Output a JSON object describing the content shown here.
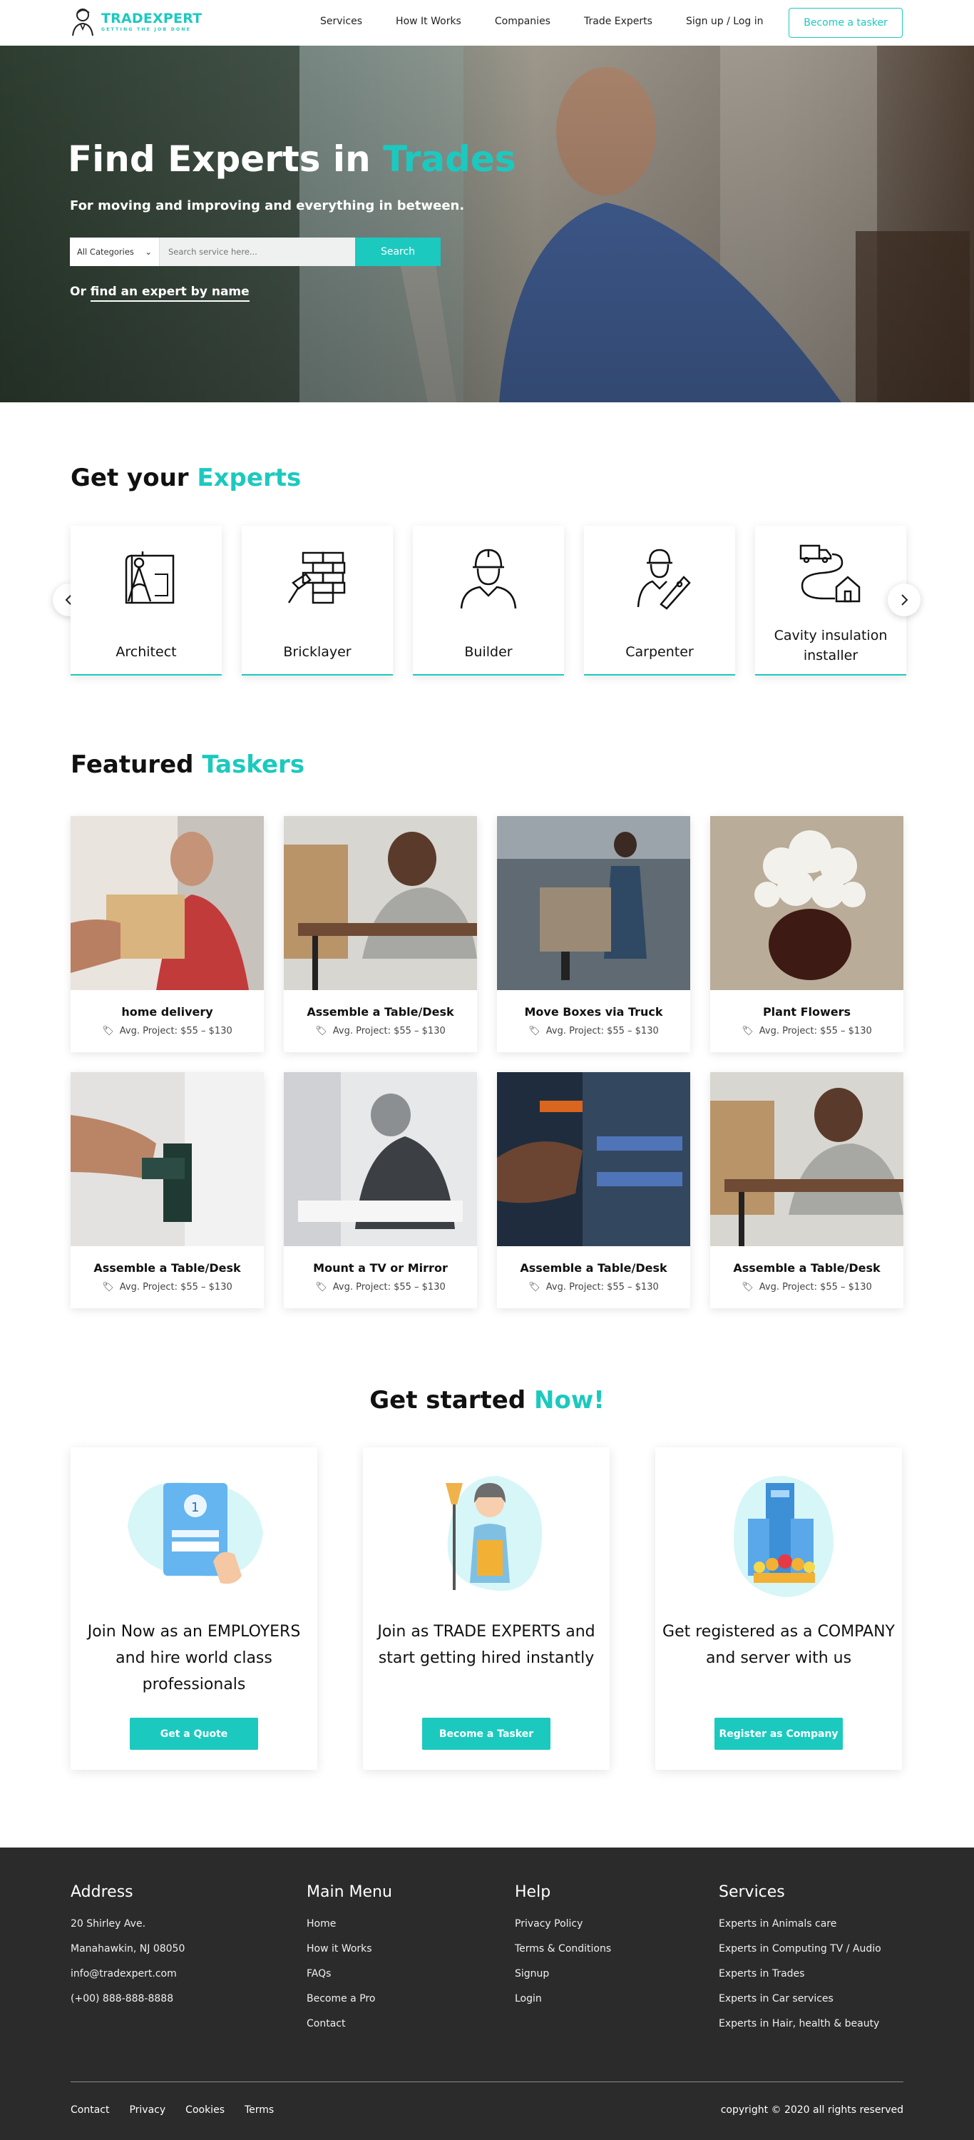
{
  "header": {
    "logo_name": "TRADEXPERT",
    "logo_tagline": "GETTING THE JOB DONE",
    "nav": [
      "Services",
      "How It Works",
      "Companies",
      "Trade Experts",
      "Sign up / Log in"
    ],
    "cta": "Become a tasker"
  },
  "hero": {
    "title_main": "Find Experts in ",
    "title_accent": "Trades",
    "subtitle": "For moving and improving and everything in between.",
    "category_selected": "All Categories",
    "search_placeholder": "Search service here...",
    "search_button": "Search",
    "find_prefix": "Or ",
    "find_link": "find an expert by name"
  },
  "experts": {
    "title_main": "Get your ",
    "title_accent": "Experts",
    "items": [
      {
        "label": "Architect",
        "icon": "architect-icon"
      },
      {
        "label": "Bricklayer",
        "icon": "bricklayer-icon"
      },
      {
        "label": "Builder",
        "icon": "builder-icon"
      },
      {
        "label": "Carpenter",
        "icon": "carpenter-icon"
      },
      {
        "label": "Cavity insulation installer",
        "icon": "cavity-insulation-icon"
      }
    ]
  },
  "taskers": {
    "title_main": "Featured ",
    "title_accent": "Taskers",
    "items": [
      {
        "name": "home delivery",
        "price": "Avg. Project: $55 – $130"
      },
      {
        "name": "Assemble a Table/Desk",
        "price": "Avg. Project: $55 – $130"
      },
      {
        "name": "Move Boxes via Truck",
        "price": "Avg. Project: $55 – $130"
      },
      {
        "name": "Plant Flowers",
        "price": "Avg. Project: $55 – $130"
      },
      {
        "name": "Assemble a Table/Desk",
        "price": "Avg. Project: $55 – $130"
      },
      {
        "name": "Mount a TV or Mirror",
        "price": "Avg. Project: $55 – $130"
      },
      {
        "name": "Assemble a Table/Desk",
        "price": "Avg. Project: $55 – $130"
      },
      {
        "name": "Assemble a Table/Desk",
        "price": "Avg. Project: $55 – $130"
      }
    ]
  },
  "get_started": {
    "title_main": "Get started ",
    "title_accent": "Now!",
    "cards": [
      {
        "text": "Join Now as an EMPLOYERS and hire world class professionals",
        "button": "Get a Quote"
      },
      {
        "text": "Join as TRADE EXPERTS and start getting hired instantly",
        "button": "Become a Tasker"
      },
      {
        "text": "Get registered as a COMPANY and server with us",
        "button": "Register as Company"
      }
    ]
  },
  "footer": {
    "address": {
      "heading": "Address",
      "lines": [
        "20 Shirley Ave.",
        "Manahawkin, NJ 08050",
        "info@tradexpert.com",
        "(+00) 888-888-8888"
      ]
    },
    "main_menu": {
      "heading": "Main Menu",
      "links": [
        "Home",
        "How it Works",
        "FAQs",
        "Become a Pro",
        "Contact"
      ]
    },
    "help": {
      "heading": "Help",
      "links": [
        "Privacy Policy",
        "Terms & Conditions",
        "Signup",
        "Login"
      ]
    },
    "services": {
      "heading": "Services",
      "links": [
        "Experts in Animals care",
        "Experts in Computing TV / Audio",
        "Experts in Trades",
        "Experts in Car services",
        "Experts in Hair, health & beauty"
      ]
    },
    "bottom_links": [
      "Contact",
      "Privacy",
      "Cookies",
      "Terms"
    ],
    "copyright": "copyright © 2020 all rights reserved"
  },
  "colors": {
    "accent": "#1cc9bf",
    "footer_bg": "#2b2b2b",
    "text": "#1c1c1c"
  }
}
